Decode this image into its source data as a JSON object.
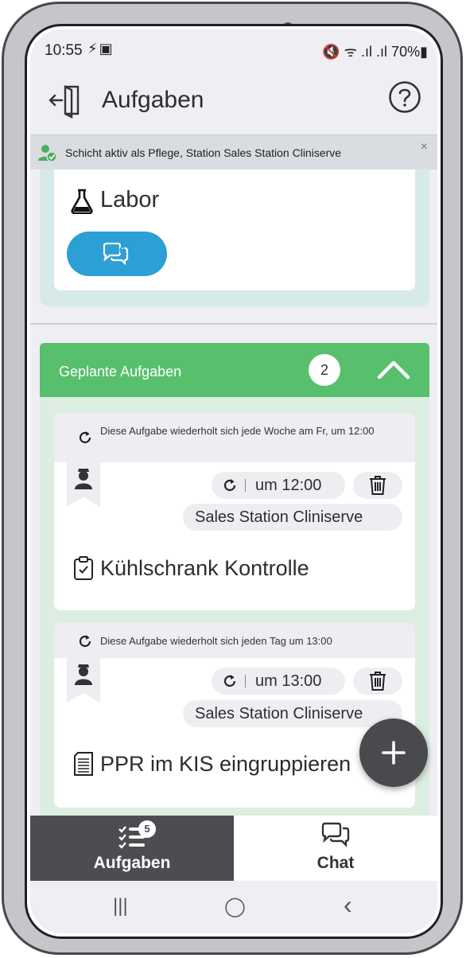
{
  "status_bar": {
    "time": "10:55",
    "left_icons": "⚡▣",
    "right_text": "🔇 ᯤ .ıl .ıl 70%▮"
  },
  "header": {
    "title": "Aufgaben",
    "logout_icon": "logout-door-icon",
    "help_icon": "help-circle-icon"
  },
  "shift_banner": {
    "text": "Schicht aktiv als Pflege, Station Sales Station Cliniserve",
    "close": "×"
  },
  "labor_card": {
    "title": "Labor",
    "chat_count": "0"
  },
  "planned": {
    "title": "Geplante Aufgaben",
    "count": "2"
  },
  "tasks": [
    {
      "repeat_text": "Diese Aufgabe wiederholt sich jede Woche am Fr, um 12:00",
      "time": "um 12:00",
      "station": "Sales Station Cliniserve",
      "title": "Kühlschrank Kontrolle"
    },
    {
      "repeat_text": "Diese Aufgabe wiederholt sich jeden Tag um 13:00",
      "time": "um 13:00",
      "station": "Sales Station Cliniserve",
      "title": "PPR im KIS eingruppieren"
    }
  ],
  "bottom_nav": {
    "tasks_label": "Aufgaben",
    "tasks_badge": "5",
    "chat_label": "Chat"
  },
  "system_nav": {
    "recents": "|||",
    "home": "◯",
    "back": "‹"
  },
  "colors": {
    "accent_blue": "#2c9fd6",
    "section_green": "#58bf6c",
    "nav_dark": "#4d4d51"
  }
}
